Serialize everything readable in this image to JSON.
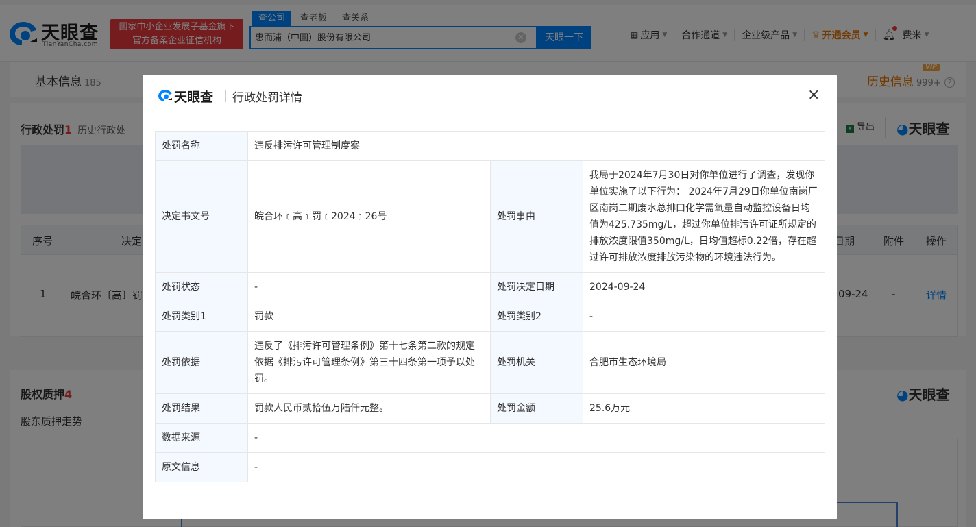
{
  "header": {
    "logo_cn": "天眼查",
    "logo_en": "TianYanCha.com",
    "badge_line1": "国家中小企业发展子基金旗下",
    "badge_line2": "官方备案企业征信机构",
    "search_tabs": [
      "查公司",
      "查老板",
      "查关系"
    ],
    "search_value": "惠而浦（中国）股份有限公司",
    "search_button": "天眼一下",
    "nav": {
      "apps": "应用",
      "channel": "合作通道",
      "enterprise": "企业级产品",
      "vip": "开通会员",
      "user": "费米"
    }
  },
  "page": {
    "tabs": [
      {
        "label": "基本信息",
        "count": "185"
      },
      {
        "label": "历史信息",
        "count": "999+",
        "vip": "VIP"
      }
    ],
    "penalty_section": {
      "title": "行政处罚",
      "count": "1",
      "subtitle": "历史行政处",
      "export": "导出",
      "watermark": "天眼查"
    },
    "table_headers": {
      "index": "序号",
      "doc": "决定",
      "date": "日期",
      "attachment": "附件",
      "action": "操作"
    },
    "row": {
      "index": "1",
      "doc": "皖合环〔高〕罚",
      "date": "09-24",
      "attachment": "-",
      "action": "详情"
    },
    "equity_section": {
      "title": "股权质押",
      "count": "4",
      "trend": "股东质押走势",
      "watermark": "天眼查"
    }
  },
  "modal": {
    "logo_cn": "天眼查",
    "title": "行政处罚详情",
    "close": "×",
    "rows": {
      "name_label": "处罚名称",
      "name_value": "违反排污许可管理制度案",
      "doc_label": "决定书文号",
      "doc_value": "皖合环﹝高﹞罚﹝2024﹞26号",
      "reason_label": "处罚事由",
      "reason_value": "我局于2024年7月30日对你单位进行了调查，发现你单位实施了以下行为： 2024年7月29日你单位南岗厂区南岗二期废水总排口化学需氧量自动监控设备日均值为425.735mg/L，超过你单位排污许可证所规定的排放浓度限值350mg/L，日均值超标0.22倍，存在超过许可排放浓度排放污染物的环境违法行为。",
      "status_label": "处罚状态",
      "status_value": "-",
      "date_label": "处罚决定日期",
      "date_value": "2024-09-24",
      "type1_label": "处罚类别1",
      "type1_value": "罚款",
      "type2_label": "处罚类别2",
      "type2_value": "-",
      "basis_label": "处罚依据",
      "basis_value": "违反了《排污许可管理条例》第十七条第二款的规定依据《排污许可管理条例》第三十四条第一项予以处罚。",
      "authority_label": "处罚机关",
      "authority_value": "合肥市生态环境局",
      "result_label": "处罚结果",
      "result_value": "罚款人民币贰拾伍万陆仟元整。",
      "amount_label": "处罚金额",
      "amount_value": "25.6万元",
      "source_label": "数据来源",
      "source_value": "-",
      "original_label": "原文信息",
      "original_value": "-"
    }
  },
  "colors": {
    "brand_blue": "#0084ff",
    "red": "#e8383d",
    "vip_orange": "#e67300",
    "label_bg": "#f4f8ff"
  }
}
